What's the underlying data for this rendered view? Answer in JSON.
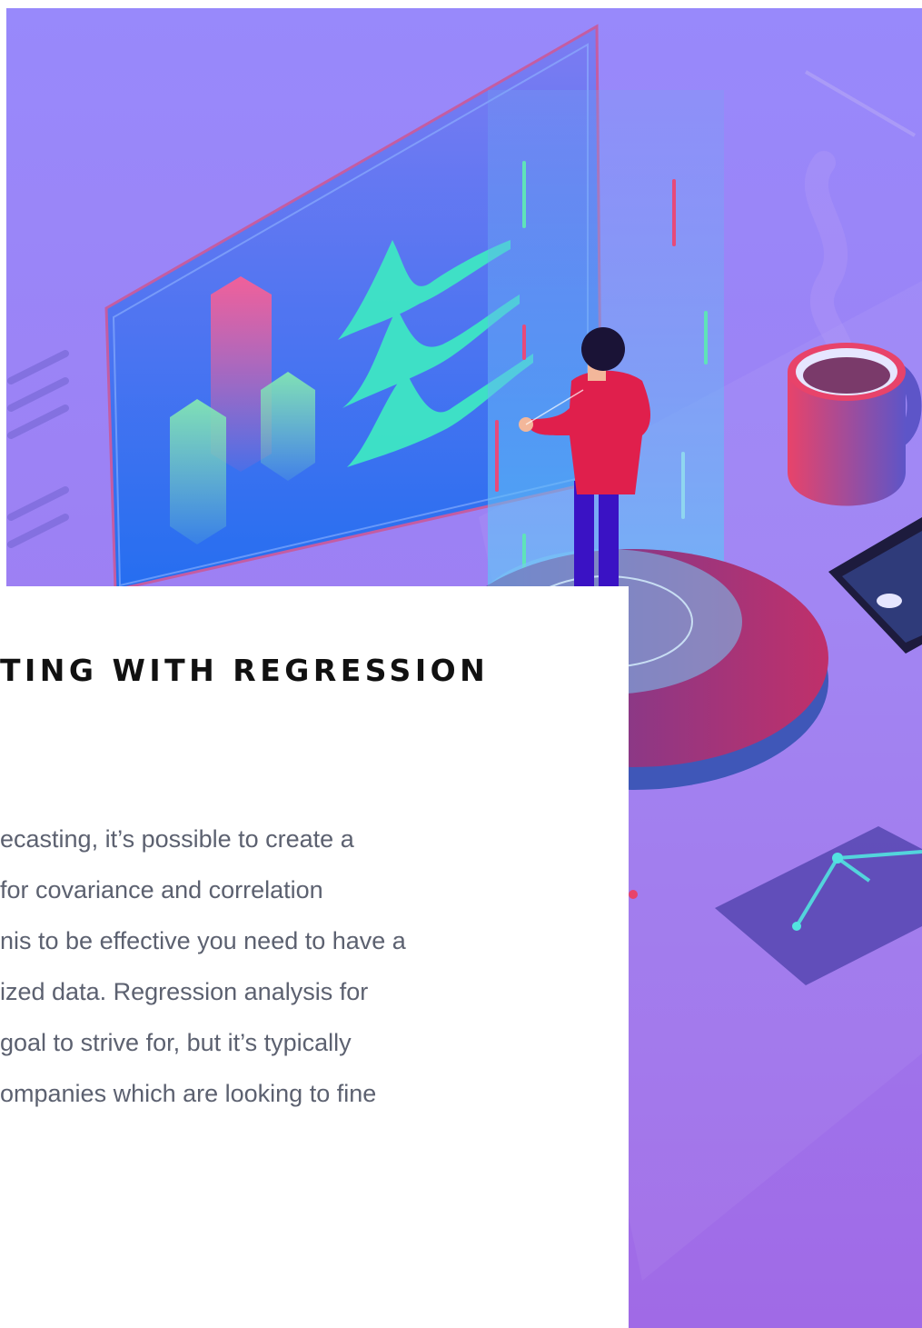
{
  "article": {
    "heading": "TING WITH REGRESSION",
    "body_lines": [
      "ecasting, it’s possible to create a",
      "for covariance and correlation",
      "nis to be effective you need to have a",
      "ized data. Regression analysis for",
      "goal to strive for, but it’s typically",
      "ompanies which are looking to fine"
    ]
  }
}
